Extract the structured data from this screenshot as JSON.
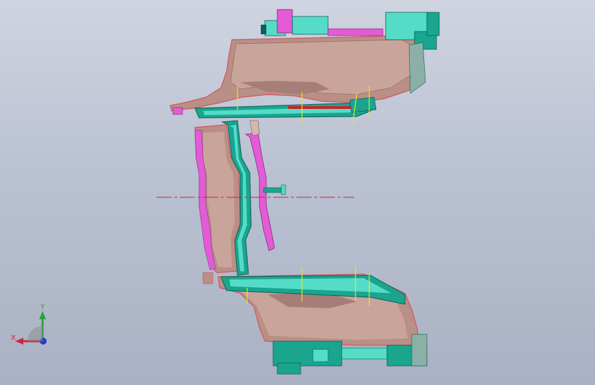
{
  "viewport": {
    "background_top": "#cfd4e0",
    "background_bottom": "#a9b1c4"
  },
  "model": {
    "colors": {
      "body": "#b98f86",
      "body_light": "#d8b6ad",
      "body_dark": "#7a5a55",
      "edge": "#d4545e",
      "teal": "#1aa58f",
      "teal_light": "#55dcc8",
      "teal_dark": "#0b5f55",
      "magenta": "#e35bd5",
      "centerline": "#d21f2a",
      "marker": "#e8e52a",
      "outline": "#2a2a2a"
    }
  },
  "triad": {
    "x_label": "X",
    "y_label": "Y",
    "x_color": "#d2233a",
    "y_color": "#2aa43a",
    "z_color": "#2d3ad4"
  }
}
